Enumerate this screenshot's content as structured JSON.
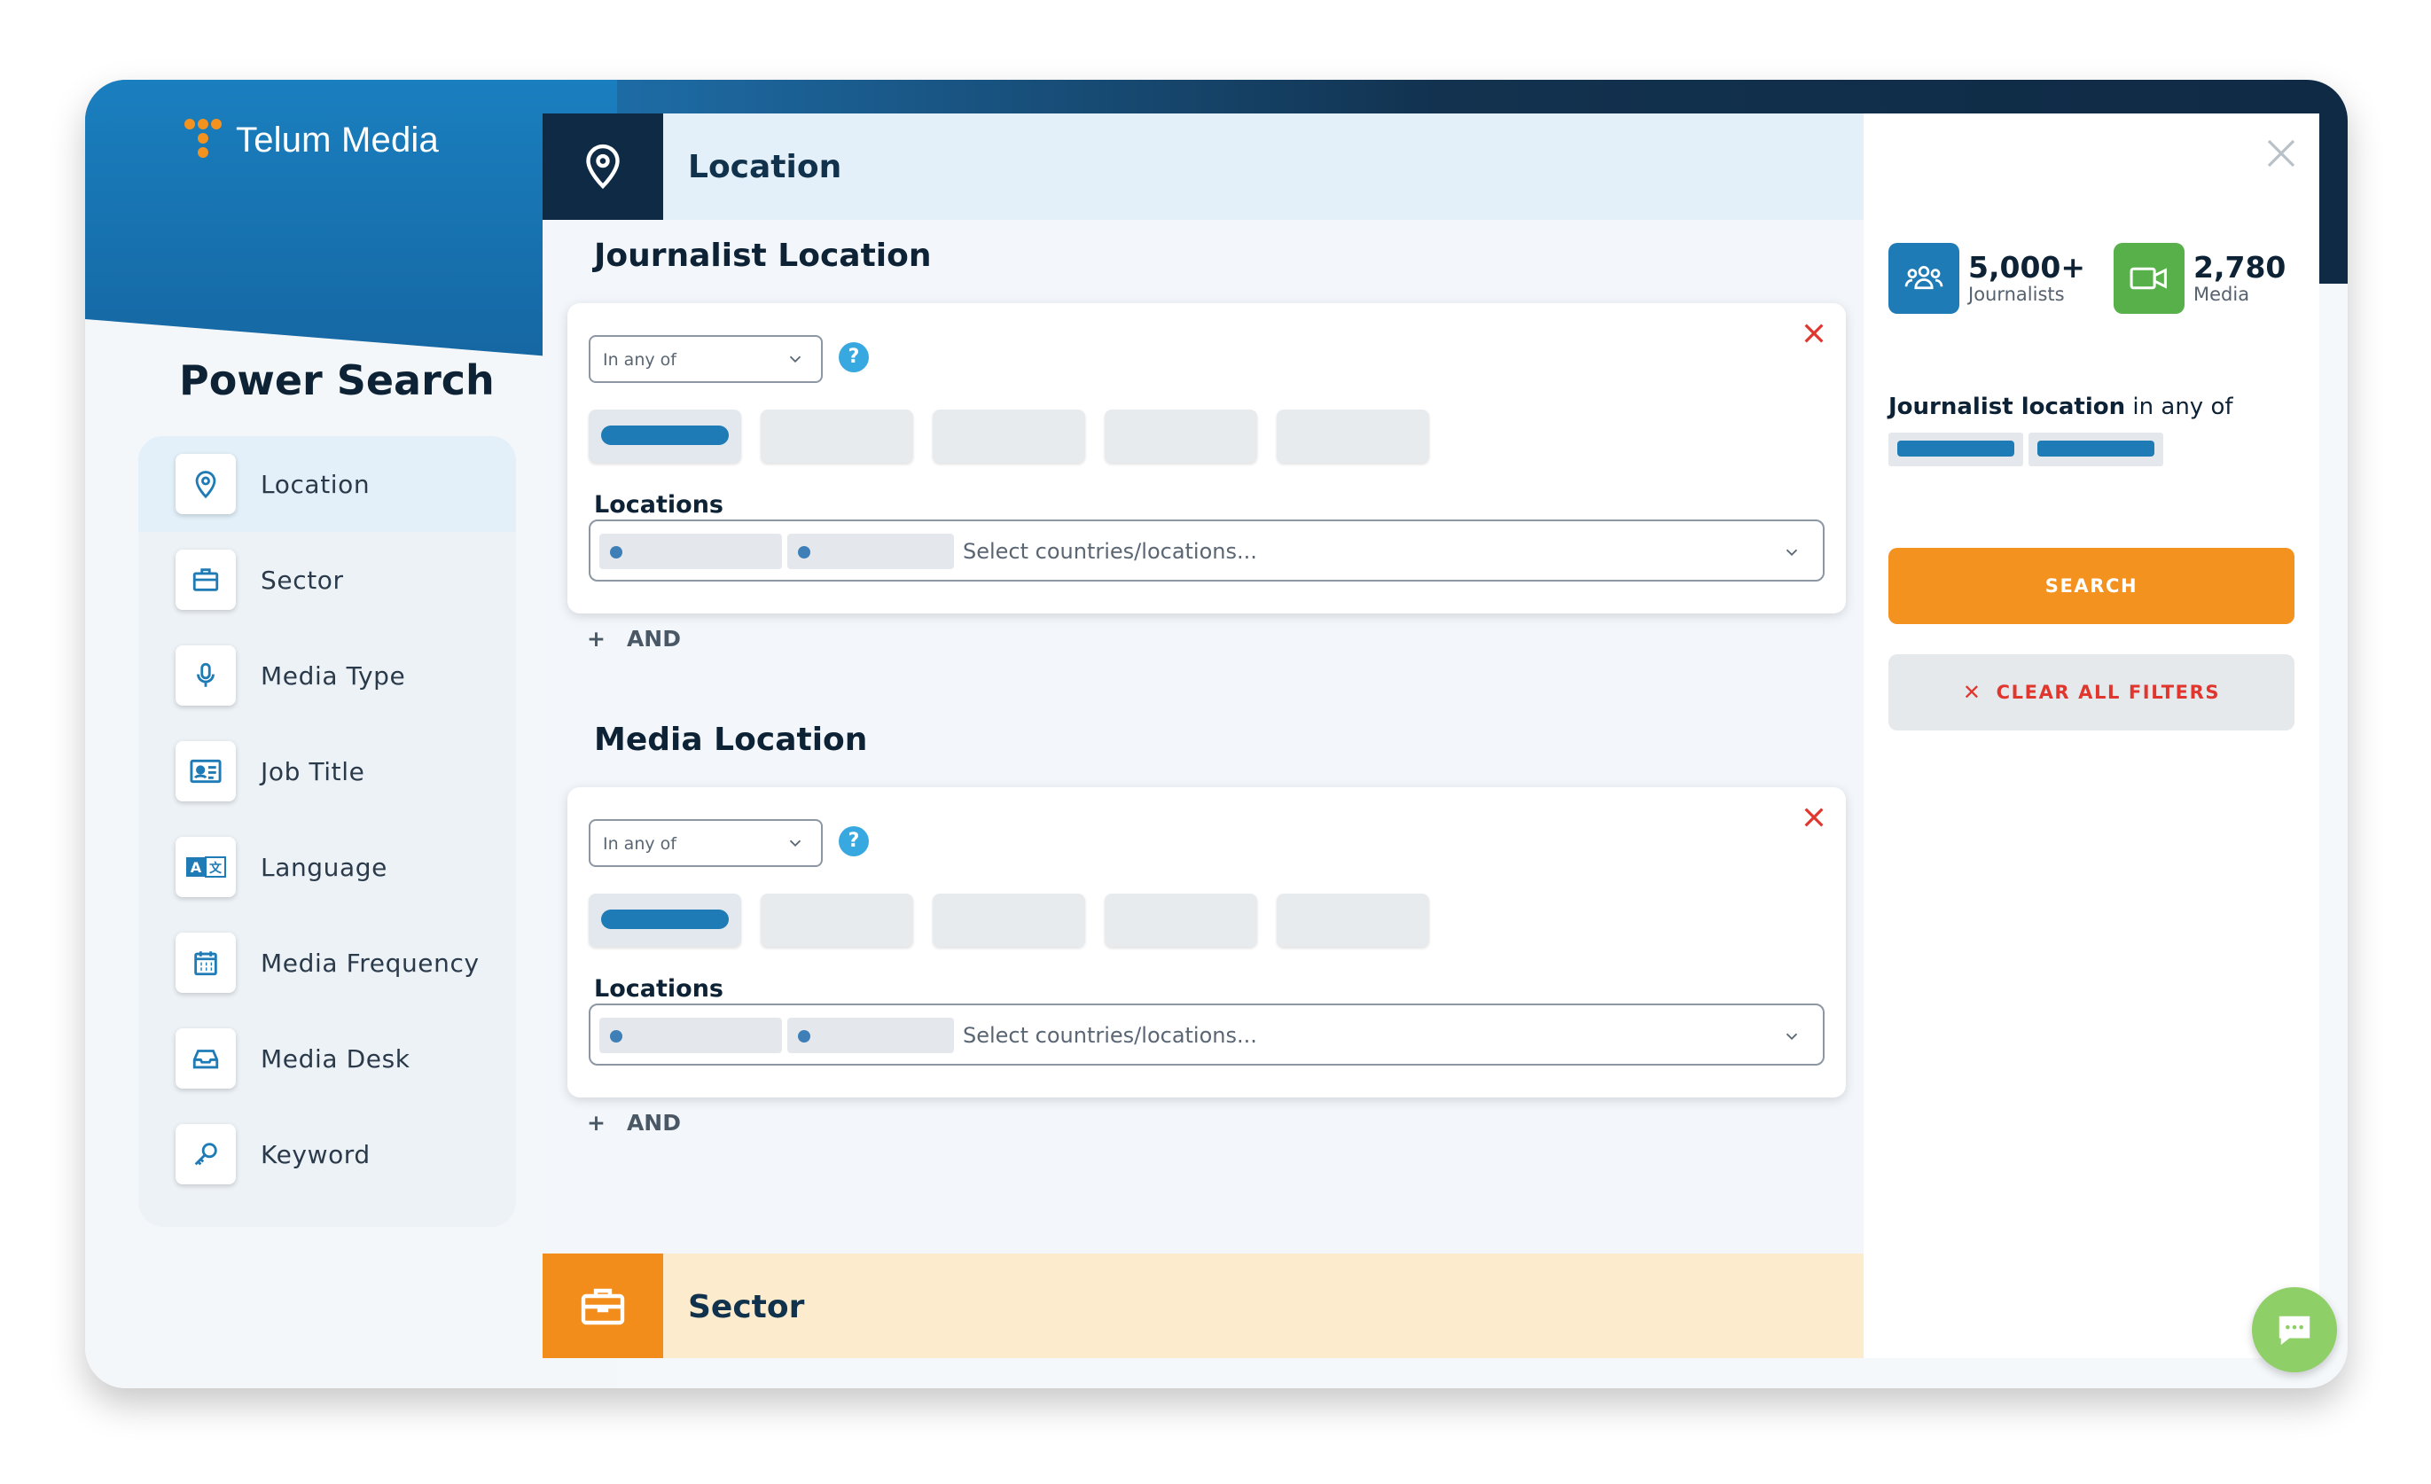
{
  "brand": {
    "name": "Telum Media",
    "accent": "#f3921f",
    "primary": "#1f7bb6"
  },
  "sidebar": {
    "title": "Power Search",
    "items": [
      {
        "label": "Location",
        "icon": "map-pin-icon",
        "active": true
      },
      {
        "label": "Sector",
        "icon": "briefcase-icon"
      },
      {
        "label": "Media Type",
        "icon": "microphone-icon"
      },
      {
        "label": "Job Title",
        "icon": "id-card-icon"
      },
      {
        "label": "Language",
        "icon": "translate-icon"
      },
      {
        "label": "Media Frequency",
        "icon": "calendar-icon"
      },
      {
        "label": "Media Desk",
        "icon": "inbox-icon"
      },
      {
        "label": "Keyword",
        "icon": "key-icon"
      }
    ]
  },
  "main": {
    "location_section": {
      "title": "Location",
      "icon": "map-pin-icon"
    },
    "journalist_location": {
      "title": "Journalist Location",
      "operator": "In any of",
      "locations_label": "Locations",
      "placeholder": "Select countries/locations...",
      "and_label": "AND"
    },
    "media_location": {
      "title": "Media Location",
      "operator": "In any of",
      "locations_label": "Locations",
      "placeholder": "Select countries/locations...",
      "and_label": "AND"
    },
    "sector_section": {
      "title": "Sector",
      "icon": "briefcase-icon"
    }
  },
  "panel": {
    "journalists": {
      "count": "5,000+",
      "label": "Journalists",
      "icon": "people-icon",
      "color": "#1f7bb6"
    },
    "media": {
      "count": "2,780",
      "label": "Media",
      "icon": "video-icon",
      "color": "#57b04a"
    },
    "summary": {
      "field": "Journalist location",
      "operator": "in any of"
    },
    "search_label": "SEARCH",
    "clear_label": "CLEAR ALL FILTERS"
  }
}
